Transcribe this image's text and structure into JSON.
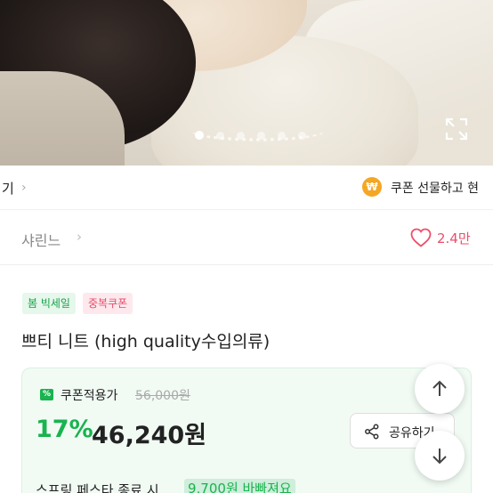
{
  "hero": {
    "carousel_dots": 6,
    "active_dot": 1,
    "icons": [
      "expand-icon"
    ]
  },
  "strip": {
    "left_text": "기",
    "coupon_badge": "₩",
    "right_text": "쿠폰 선물하고 현"
  },
  "shop": {
    "name": "샤린느",
    "like_count": "2.4만"
  },
  "tags": [
    "봄 빅세일",
    "중복쿠폰"
  ],
  "product": {
    "title": "쁘티 니트 (high quality수입의류)"
  },
  "price": {
    "coupon_icon": "%",
    "coupon_label": "쿠폰적용가",
    "original": "56,000원",
    "discount": "17%",
    "final": "46,240원",
    "share_label": "공유하기"
  },
  "promo": {
    "text": "스프링 페스타 종료 시",
    "highlight": "9,700원 바빠져요"
  },
  "colors": {
    "accent_green": "#19b34f",
    "heart_pink": "#ec4f6b",
    "coupon_orange": "#f5a623"
  }
}
